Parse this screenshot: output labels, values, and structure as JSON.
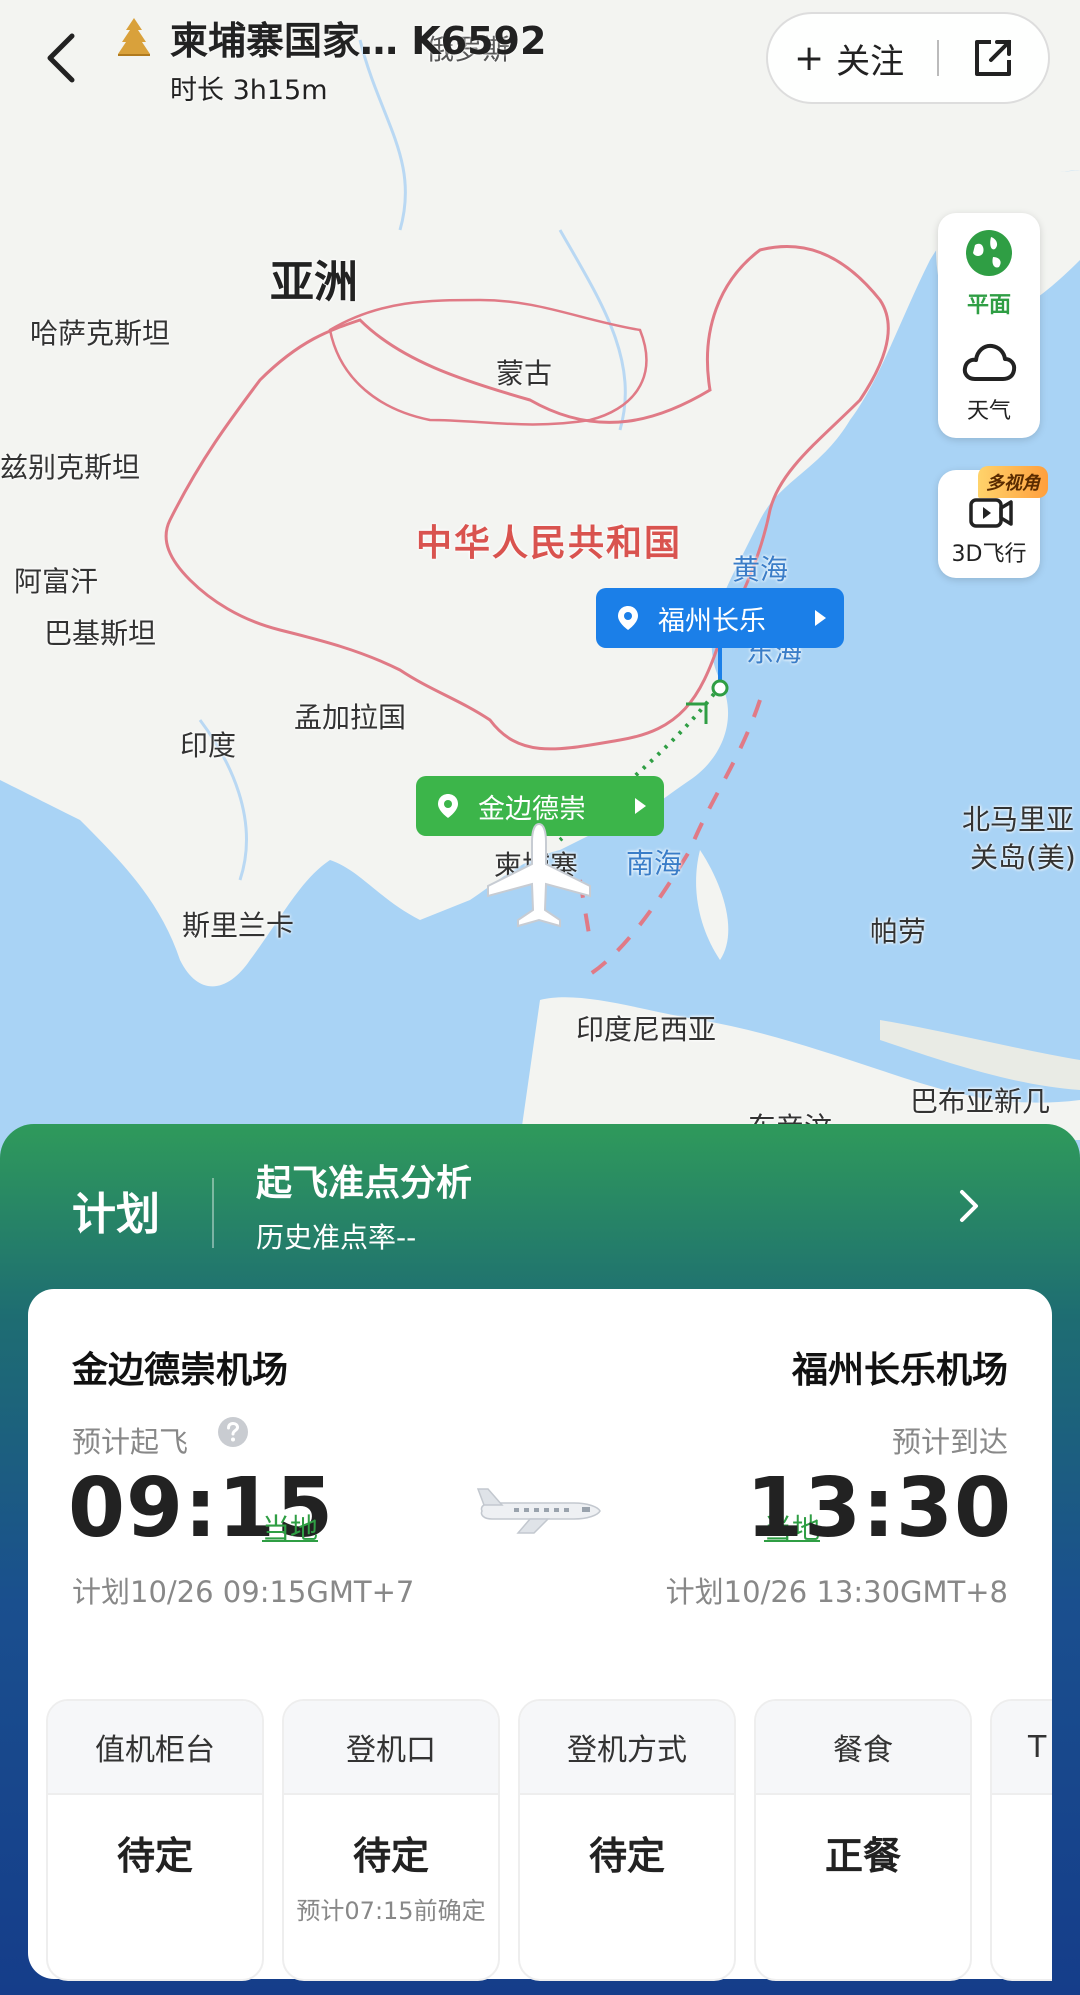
{
  "header": {
    "flight_title": "柬埔寨国家… K6592",
    "duration": "时长 3h15m",
    "follow_label": "关注",
    "follow_plus": "+"
  },
  "map": {
    "labels": {
      "russia": "俄罗斯",
      "asia": "亚洲",
      "kazakhstan": "哈萨克斯坦",
      "mongolia": "蒙古",
      "uzbekistan": "兹别克斯坦",
      "china": "中华人民共和国",
      "yellow_sea": "黄海",
      "east_sea": "东海",
      "afghanistan": "阿富汗",
      "pakistan": "巴基斯坦",
      "bangladesh": "孟加拉国",
      "india": "印度",
      "cambodia": "柬埔寨",
      "south_sea": "南海",
      "sri_lanka": "斯里兰卡",
      "palau": "帕劳",
      "indonesia": "印度尼西亚",
      "northern_mariana": "北马里亚",
      "guam": "关岛(美)",
      "papua": "巴布亚新几",
      "east_timor": "东帝汶"
    },
    "arrival_callout": "福州长乐",
    "departure_callout": "金边德崇"
  },
  "right_panel": {
    "flat_label": "平面",
    "weather_label": "天气",
    "multi_view_badge": "多视角",
    "fly3d_label": "3D飞行"
  },
  "sheet": {
    "plan_label": "计划",
    "ontime_title": "起飞准点分析",
    "ontime_rate": "历史准点率--"
  },
  "card": {
    "departure": {
      "airport": "金边德崇机场",
      "label": "预计起飞",
      "time": "09:15",
      "local": "当地",
      "planned": "计划10/26 09:15GMT+7"
    },
    "arrival": {
      "airport": "福州长乐机场",
      "label": "预计到达",
      "time": "13:30",
      "local": "当地",
      "planned": "计划10/26 13:30GMT+8"
    },
    "tiles": [
      {
        "title": "值机柜台",
        "value": "待定",
        "note": ""
      },
      {
        "title": "登机口",
        "value": "待定",
        "note": "预计07:15前确定"
      },
      {
        "title": "登机方式",
        "value": "待定",
        "note": ""
      },
      {
        "title": "餐食",
        "value": "正餐",
        "note": ""
      },
      {
        "title": "T",
        "value": "",
        "note": ""
      }
    ]
  },
  "colors": {
    "accent_green": "#2f9e44",
    "callout_blue": "#1b7fe8",
    "callout_green": "#3cb54a",
    "border_red": "#d9534f"
  }
}
